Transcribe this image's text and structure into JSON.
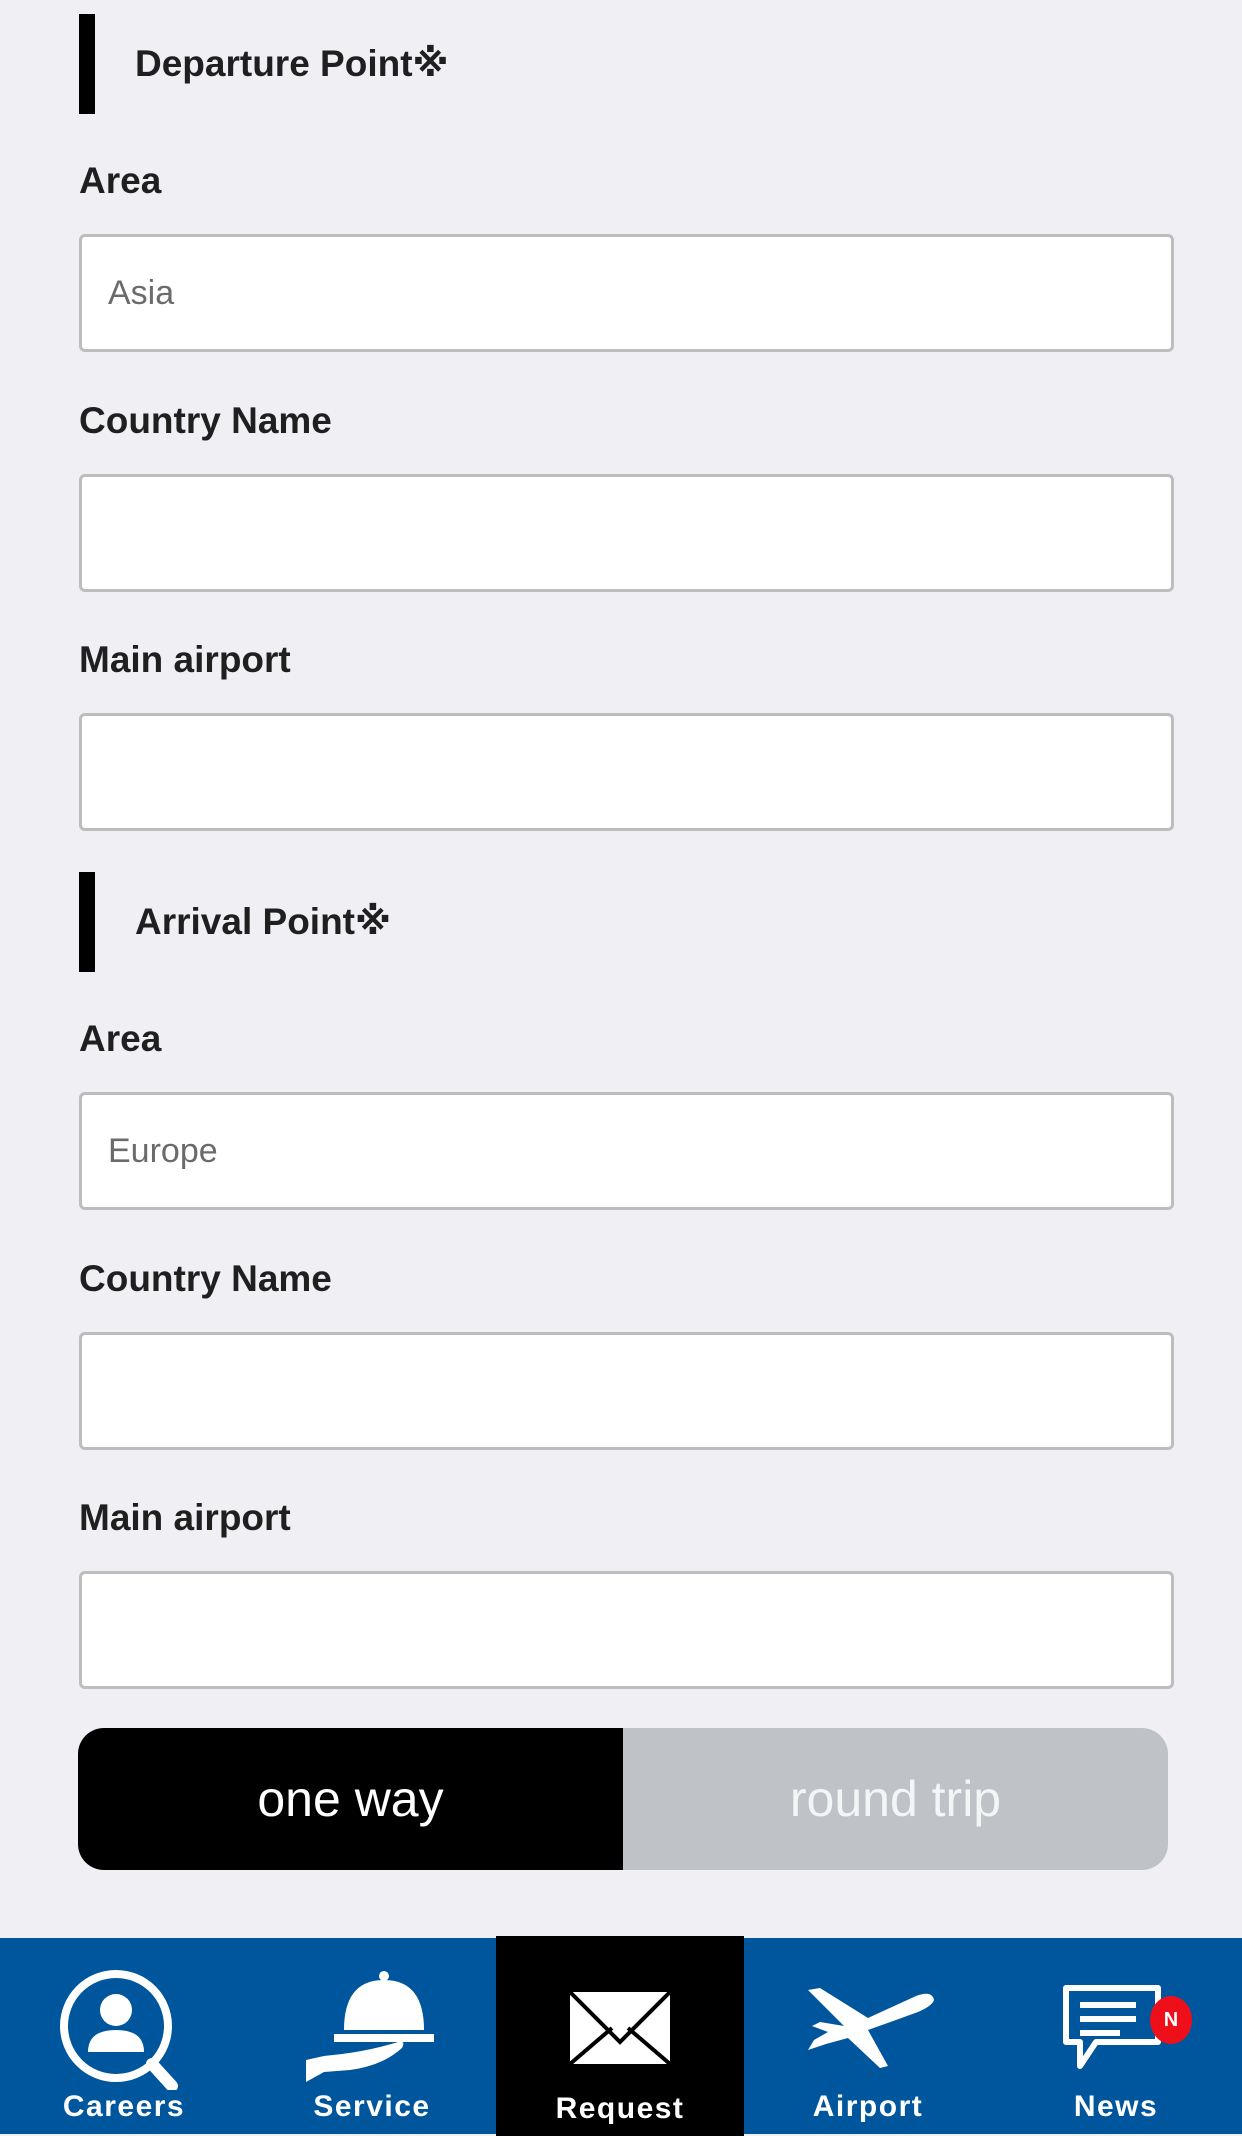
{
  "departure": {
    "title": "Departure Point※",
    "area": {
      "label": "Area",
      "placeholder": "Asia",
      "value": ""
    },
    "country": {
      "label": "Country Name",
      "placeholder": "",
      "value": ""
    },
    "airport": {
      "label": "Main airport",
      "placeholder": "",
      "value": ""
    }
  },
  "arrival": {
    "title": "Arrival Point※",
    "area": {
      "label": "Area",
      "placeholder": "Europe",
      "value": ""
    },
    "country": {
      "label": "Country Name",
      "placeholder": "",
      "value": ""
    },
    "airport": {
      "label": "Main airport",
      "placeholder": "",
      "value": ""
    }
  },
  "trip_type": {
    "options": [
      "one way",
      "round trip"
    ],
    "selected": "one way"
  },
  "bottom_nav": {
    "items": [
      {
        "label": "Careers",
        "icon": "careers-search-person-icon",
        "active": false
      },
      {
        "label": "Service",
        "icon": "service-cloche-icon",
        "active": false
      },
      {
        "label": "Request",
        "icon": "envelope-icon",
        "active": true
      },
      {
        "label": "Airport",
        "icon": "airplane-icon",
        "active": false
      },
      {
        "label": "News",
        "icon": "news-chat-icon",
        "active": false,
        "badge": "N"
      }
    ]
  },
  "colors": {
    "nav_bg": "#00569c",
    "nav_active_bg": "#000000",
    "toggle_active": "#000000",
    "toggle_inactive": "#bfc3c7",
    "badge": "#ef0f1a",
    "page_bg": "#efeff4"
  }
}
